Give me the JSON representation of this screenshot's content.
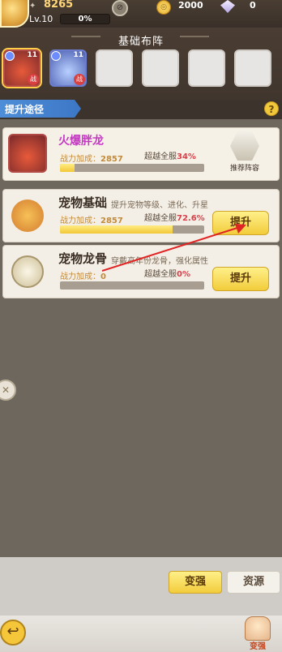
{
  "topbar": {
    "power": "8265",
    "level": "Lv.10",
    "exp_percent": "0%",
    "coins": "2000",
    "gems": "0"
  },
  "lineup": {
    "title": "基础布阵",
    "slots": [
      {
        "level": "11",
        "badge": "战"
      },
      {
        "level": "11",
        "badge": "战"
      },
      {
        "level": ""
      },
      {
        "level": ""
      },
      {
        "level": ""
      },
      {
        "level": ""
      }
    ]
  },
  "upgrade_path": {
    "label": "提升途径",
    "help": "?"
  },
  "hero_card": {
    "name": "火爆胖龙",
    "power_label": "战力加成：",
    "power_value": "2857",
    "rank_label": "超越全服",
    "rank_value": "34%",
    "progress": 0.1,
    "recommend_label": "推荐阵容"
  },
  "cards": [
    {
      "title": "宠物基础",
      "subtitle": "提升宠物等级、进化、升星",
      "power_label": "战力加成：",
      "power_value": "2857",
      "rank_label": "超越全服",
      "rank_value": "72.6%",
      "progress": 0.78,
      "button": "提升"
    },
    {
      "title": "宠物龙骨",
      "subtitle": "穿戴高年份龙骨，强化属性",
      "power_label": "战力加成：",
      "power_value": "0",
      "rank_label": "超越全服",
      "rank_value": "0%",
      "progress": 0.0,
      "button": "提升"
    }
  ],
  "tabs": {
    "strong": "变强",
    "resources": "资源"
  },
  "footer": {
    "back": "↩",
    "strong_label": "变强"
  },
  "colors": {
    "accent_yellow": "#f2cc3b",
    "path_blue": "#3c77c6",
    "rank_red": "#d9404a",
    "hero_name": "#c43ac2"
  }
}
